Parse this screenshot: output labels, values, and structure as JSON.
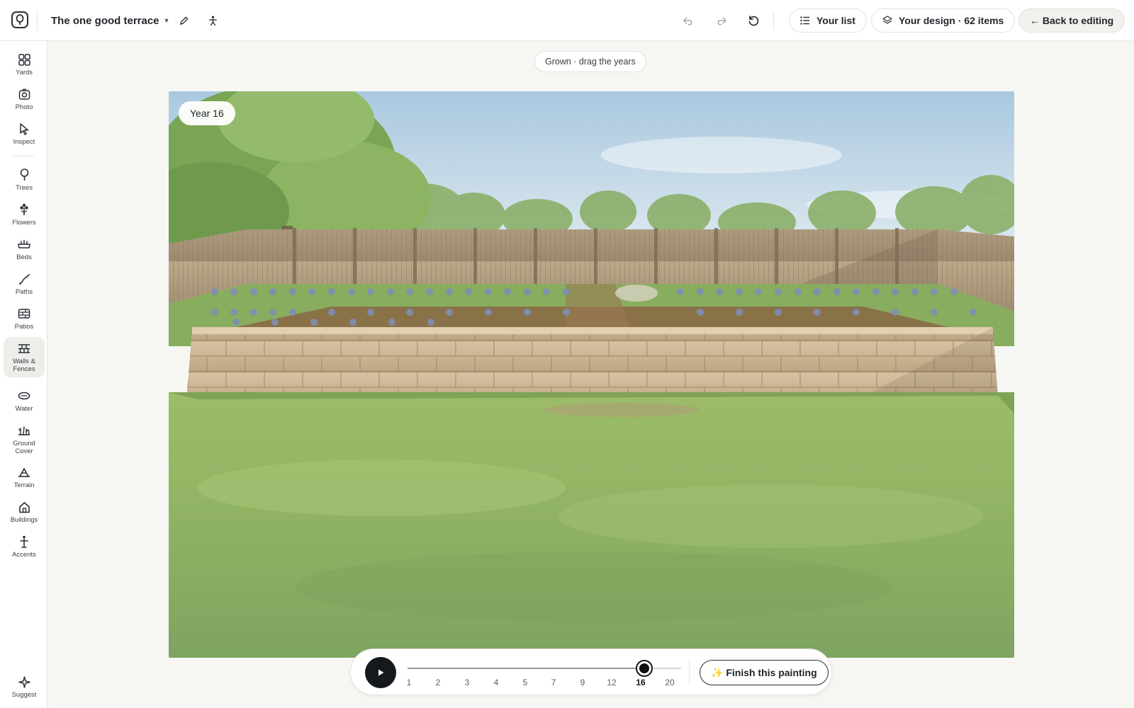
{
  "header": {
    "project_title": "The one good terrace",
    "your_list_label": "Your list",
    "design_label": "Your design ·",
    "design_count": "62 items",
    "back_label": "← Back to editing"
  },
  "sidebar": {
    "items": [
      {
        "label": "Yards",
        "icon": "grid-icon"
      },
      {
        "label": "Photo",
        "icon": "camera-icon"
      },
      {
        "label": "Inspect",
        "icon": "cursor-icon"
      },
      {
        "label": "Trees",
        "icon": "tree-icon"
      },
      {
        "label": "Flowers",
        "icon": "flower-icon"
      },
      {
        "label": "Beds",
        "icon": "bed-icon"
      },
      {
        "label": "Paths",
        "icon": "path-icon"
      },
      {
        "label": "Patios",
        "icon": "patio-icon"
      },
      {
        "label": "Walls & Fences",
        "icon": "wall-icon",
        "active": true
      },
      {
        "label": "Water",
        "icon": "water-icon"
      },
      {
        "label": "Ground Cover",
        "icon": "ground-cover-icon"
      },
      {
        "label": "Terrain",
        "icon": "terrain-icon"
      },
      {
        "label": "Buildings",
        "icon": "house-icon"
      },
      {
        "label": "Accents",
        "icon": "accent-icon"
      },
      {
        "label": "Suggest",
        "icon": "sparkle-icon"
      }
    ]
  },
  "main": {
    "hint": "Grown · drag the years",
    "year_badge": "Year 16"
  },
  "timeline": {
    "years": [
      "1",
      "2",
      "3",
      "4",
      "5",
      "7",
      "9",
      "12",
      "16",
      "20"
    ],
    "selected_year": "16",
    "finish_label": "✨ Finish this painting"
  },
  "colors": {
    "accent_dark": "#15181c",
    "active_nav_bg": "#eceeea"
  }
}
